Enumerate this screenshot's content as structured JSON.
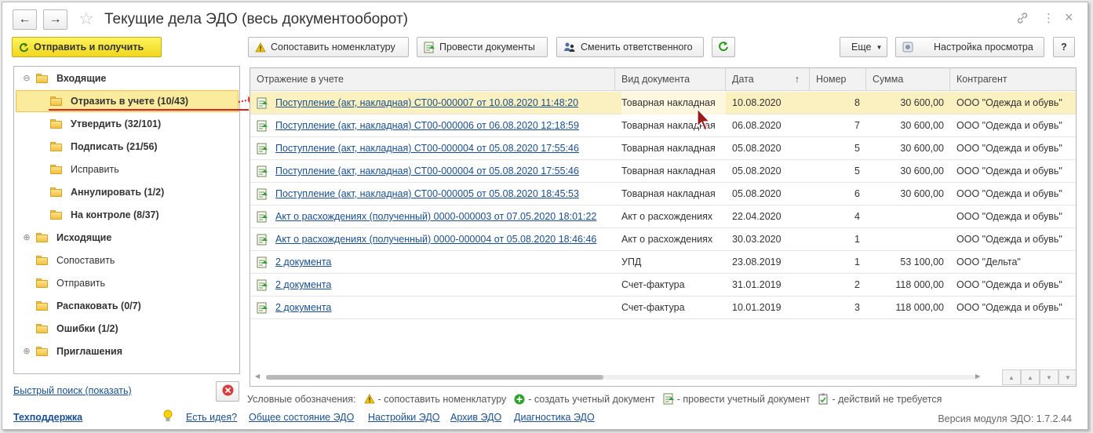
{
  "window": {
    "title": "Текущие дела ЭДО (весь документооборот)",
    "nav_back": "←",
    "nav_forward": "→",
    "star": "☆",
    "icons": {
      "link": "🔗",
      "more": "⋮",
      "close": "×"
    }
  },
  "toolbar": {
    "send_receive": "Отправить и получить",
    "match": "Сопоставить номенклатуру",
    "post": "Провести документы",
    "change_resp": "Сменить ответственного",
    "refresh": "⟳",
    "more": "Еще",
    "settings": "Настройка просмотра",
    "help": "?"
  },
  "tree": [
    {
      "label": "Входящие",
      "bold": true,
      "level": 0,
      "expander": "⊖"
    },
    {
      "label": "Отразить в учете (10/43)",
      "bold": true,
      "level": 1,
      "selected": true
    },
    {
      "label": "Утвердить (32/101)",
      "bold": true,
      "level": 1
    },
    {
      "label": "Подписать (21/56)",
      "bold": true,
      "level": 1
    },
    {
      "label": "Исправить",
      "bold": false,
      "level": 1
    },
    {
      "label": "Аннулировать (1/2)",
      "bold": true,
      "level": 1
    },
    {
      "label": "На контроле (8/37)",
      "bold": true,
      "level": 1
    },
    {
      "label": "Исходящие",
      "bold": true,
      "level": 0,
      "expander": "⊕"
    },
    {
      "label": "Сопоставить",
      "bold": false,
      "level": 0
    },
    {
      "label": "Отправить",
      "bold": false,
      "level": 0
    },
    {
      "label": "Распаковать (0/7)",
      "bold": true,
      "level": 0
    },
    {
      "label": "Ошибки (1/2)",
      "bold": true,
      "level": 0
    },
    {
      "label": "Приглашения",
      "bold": true,
      "level": 0,
      "expander": "⊕"
    }
  ],
  "grid": {
    "columns": [
      "Отражение в учете",
      "Вид документа",
      "Дата",
      "Номер",
      "Сумма",
      "Контрагент"
    ],
    "sort_indicator": "↑",
    "rows": [
      {
        "doc": "Поступление (акт, накладная) СТ00-000007 от 10.08.2020 11:48:20",
        "type": "Товарная накладная",
        "date": "10.08.2020",
        "num": "8",
        "sum": "30 600,00",
        "party": "ООО \"Одежда и обувь\"",
        "selected": true
      },
      {
        "doc": "Поступление (акт, накладная) СТ00-000006 от 06.08.2020 12:18:59",
        "type": "Товарная накладная",
        "date": "06.08.2020",
        "num": "7",
        "sum": "30 600,00",
        "party": "ООО \"Одежда и обувь\""
      },
      {
        "doc": "Поступление (акт, накладная) СТ00-000004 от 05.08.2020 17:55:46",
        "type": "Товарная накладная",
        "date": "05.08.2020",
        "num": "5",
        "sum": "30 600,00",
        "party": "ООО \"Одежда и обувь\""
      },
      {
        "doc": "Поступление (акт, накладная) СТ00-000004 от 05.08.2020 17:55:46",
        "type": "Товарная накладная",
        "date": "05.08.2020",
        "num": "5",
        "sum": "30 600,00",
        "party": "ООО \"Одежда и обувь\""
      },
      {
        "doc": "Поступление (акт, накладная) СТ00-000005 от 05.08.2020 18:45:53",
        "type": "Товарная накладная",
        "date": "05.08.2020",
        "num": "6",
        "sum": "30 600,00",
        "party": "ООО \"Одежда и обувь\""
      },
      {
        "doc": "Акт о расхождениях (полученный) 0000-000003 от 07.05.2020 18:01:22",
        "type": "Акт о расхождениях",
        "date": "22.04.2020",
        "num": "4",
        "sum": "",
        "party": "ООО \"Одежда и обувь\""
      },
      {
        "doc": "Акт о расхождениях (полученный) 0000-000004 от 05.08.2020 18:46:46",
        "type": "Акт о расхождениях",
        "date": "30.03.2020",
        "num": "1",
        "sum": "",
        "party": "ООО \"Одежда и обувь\""
      },
      {
        "doc": "2 документа",
        "type": "УПД",
        "date": "23.08.2019",
        "num": "1",
        "sum": "53 100,00",
        "party": "ООО \"Дельта\""
      },
      {
        "doc": "2 документа",
        "type": "Счет-фактура",
        "date": "31.01.2019",
        "num": "2",
        "sum": "118 000,00",
        "party": "ООО \"Одежда и обувь\""
      },
      {
        "doc": "2 документа",
        "type": "Счет-фактура",
        "date": "10.01.2019",
        "num": "3",
        "sum": "118 000,00",
        "party": "ООО \"Одежда и обувь\""
      }
    ]
  },
  "quick_search": "Быстрый поиск (показать)",
  "legend": {
    "title": "Условные обозначения:",
    "match": "- сопоставить номенклатуру",
    "create": "- создать учетный документ",
    "post": "- провести учетный документ",
    "none": "- действий не требуется"
  },
  "footer": {
    "support": "Техподдержка",
    "idea": "Есть идея?",
    "status": "Общее состояние ЭДО",
    "settings": "Настройки ЭДО",
    "archive": "Архив ЭДО",
    "diagnostics": "Диагностика ЭДО",
    "version": "Версия модуля ЭДО: 1.7.2.44"
  },
  "colors": {
    "accent_yellow": "#f5e23a",
    "selection": "#fbeb9c",
    "link": "#1a4f8f",
    "highlight_red": "#e02020"
  }
}
